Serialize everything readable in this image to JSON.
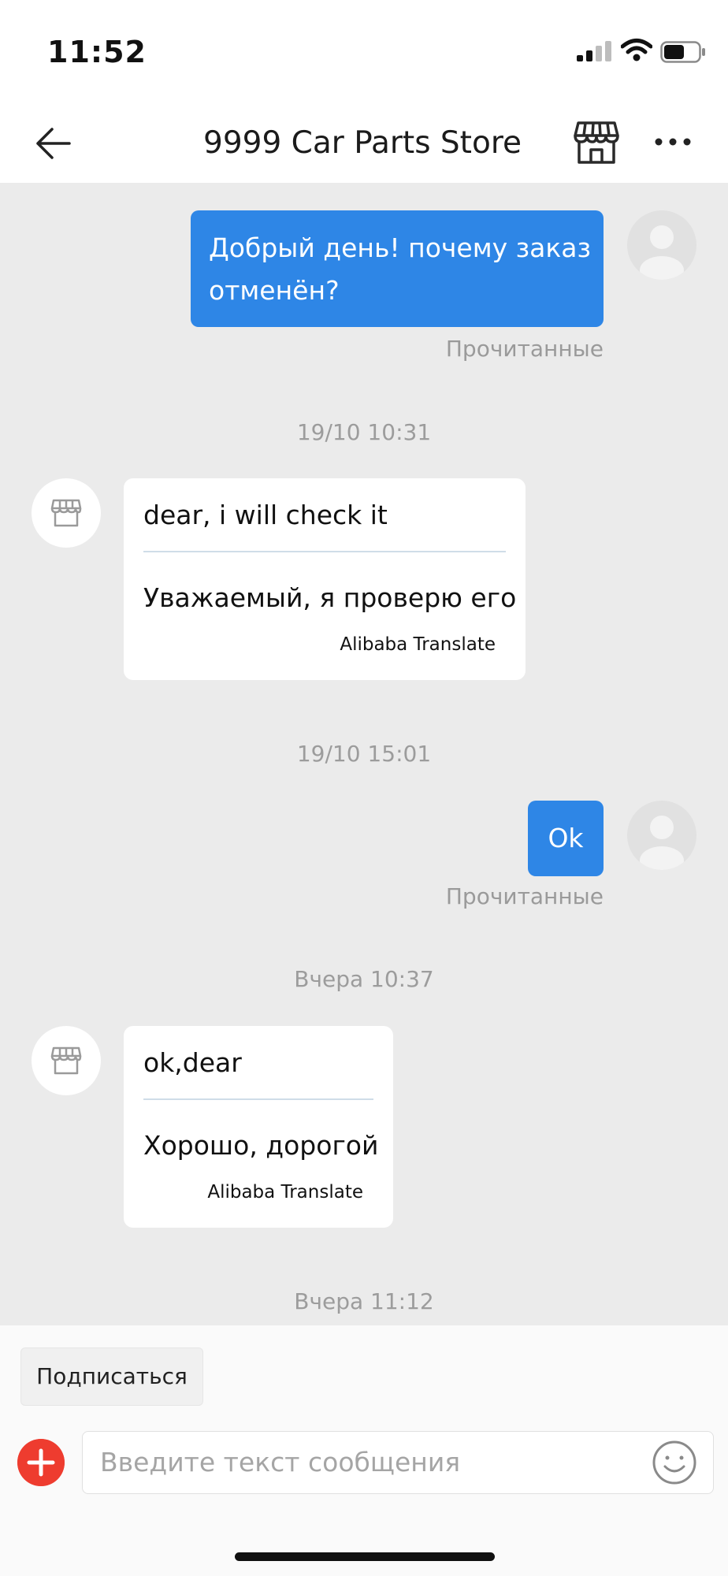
{
  "status_bar": {
    "time": "11:52",
    "battery_level": 0.6
  },
  "header": {
    "title": "9999 Car Parts Store",
    "back_icon": "arrow-left-icon",
    "store_icon": "storefront-icon",
    "more_icon": "ellipsis-icon"
  },
  "messages": [
    {
      "type": "outgoing",
      "text": "Добрый день! почему заказ отменён?",
      "text_line1": "Добрый день! почему заказ",
      "text_line2": "отменён?",
      "status": "Прочитанные"
    },
    {
      "type": "timestamp",
      "text": "19/10 10:31"
    },
    {
      "type": "incoming",
      "original": "dear, i will check it",
      "translation": "Уважаемый, я проверю его",
      "credit": "Alibaba Translate"
    },
    {
      "type": "timestamp",
      "text": "19/10 15:01"
    },
    {
      "type": "outgoing",
      "text": "Ok",
      "status": "Прочитанные"
    },
    {
      "type": "timestamp",
      "text": "Вчера 10:37"
    },
    {
      "type": "incoming",
      "original": "ok,dear",
      "translation": "Хорошо, дорогой",
      "credit": "Alibaba Translate"
    },
    {
      "type": "timestamp",
      "text": "Вчера 11:12"
    }
  ],
  "composer": {
    "subscribe_label": "Подписаться",
    "placeholder": "Введите текст сообщения",
    "plus_icon": "plus-circle-icon",
    "emoji_icon": "smiley-icon"
  },
  "colors": {
    "accent": "#2e86e6",
    "chat_background": "#ebebeb",
    "plus_button": "#ee3c2f"
  }
}
